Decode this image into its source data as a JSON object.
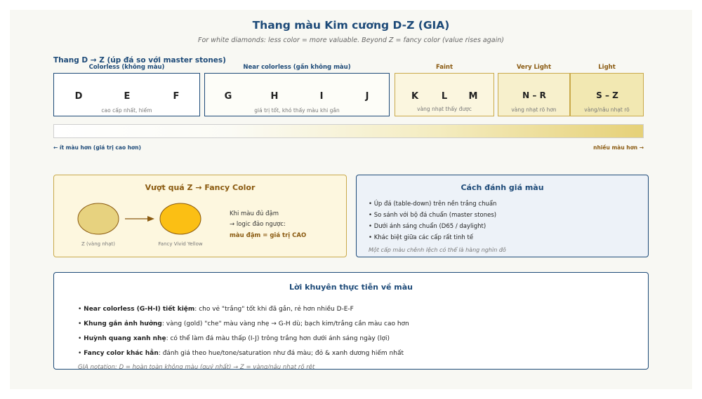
{
  "title": "Thang màu Kim cương D-Z (GIA)",
  "subtitle": "For white diamonds: less color = more valuable. Beyond Z = fancy color (value rises again)",
  "scale": {
    "title": "Thang D → Z (úp đá so với master stones)",
    "groups": [
      {
        "label": "Colorless (không màu)",
        "grades": [
          "D",
          "E",
          "F"
        ],
        "note": "cao cấp nhất, hiếm",
        "label_color": "#1d4a78",
        "border": "#1d4a78",
        "fill": "#ffffff"
      },
      {
        "label": "Near colorless (gần không màu)",
        "grades": [
          "G",
          "H",
          "I",
          "J"
        ],
        "note": "giá trị tốt, khó thấy màu khi gắn",
        "label_color": "#1d4a78",
        "border": "#1d4a78",
        "fill": "#fdfdf8"
      },
      {
        "label": "Faint",
        "grades": [
          "K",
          "L",
          "M"
        ],
        "note": "vàng nhạt thấy được",
        "label_color": "#8a5a10",
        "border": "#c9a94a",
        "fill": "#fbf6df"
      },
      {
        "label": "Very Light",
        "grades": [
          "N – R"
        ],
        "note": "vàng nhạt rõ hơn",
        "label_color": "#8a5a10",
        "border": "#c9a94a",
        "fill": "#f7f0cc"
      },
      {
        "label": "Light",
        "grades": [
          "S – Z"
        ],
        "note": "vàng/nâu nhạt rõ",
        "label_color": "#8a5a10",
        "border": "#c9a94a",
        "fill": "#f2e8b2"
      }
    ],
    "less_color": "← ít màu hơn (giá trị cao hơn)",
    "more_color": "nhiều màu hơn →"
  },
  "fancy": {
    "title": "Vượt quá Z → Fancy Color",
    "left_label": "Z (vàng nhạt)",
    "right_label": "Fancy Vivid Yellow",
    "line1": "Khi màu đủ đậm",
    "line2": "→ logic đảo ngược:",
    "line3": "màu đậm = giá trị CAO",
    "colors": {
      "pale": "#e7d27f",
      "vivid": "#fbbf14",
      "arrow": "#8a5a10"
    }
  },
  "grading": {
    "title": "Cách đánh giá màu",
    "bullets": [
      "• Úp đá (table-down) trên nền trắng chuẩn",
      "• So sánh với bộ đá chuẩn (master stones)",
      "• Dưới ánh sáng chuẩn (D65 / daylight)",
      "• Khác biệt giữa các cấp rất tinh tế"
    ],
    "note": "Một cấp màu chênh lệch có thể là hàng nghìn đô"
  },
  "tips": {
    "title": "Lời khuyên thực tiễn về màu",
    "items": [
      {
        "bold": "Near colorless (G-H-I) tiết kiệm",
        "text": ": cho vẻ \"trắng\" tốt khi đã gắn, rẻ hơn nhiều D-E-F"
      },
      {
        "bold": "Khung gắn ảnh hưởng",
        "text": ": vàng (gold) \"che\" màu vàng nhẹ → G-H dù; bạch kim/trắng cần màu cao hơn"
      },
      {
        "bold": "Huỳnh quang xanh nhẹ",
        "text": ": có thể làm đá màu thấp (I-J) trông trắng hơn dưới ánh sáng ngày (lợi)"
      },
      {
        "bold": "Fancy color khác hẳn",
        "text": ": đánh giá theo hue/tone/saturation như đá màu; đỏ & xanh dương hiếm nhất"
      }
    ],
    "note": "GIA notation: D = hoàn toàn không màu (quý nhất) → Z = vàng/nâu nhạt rõ rệt"
  }
}
